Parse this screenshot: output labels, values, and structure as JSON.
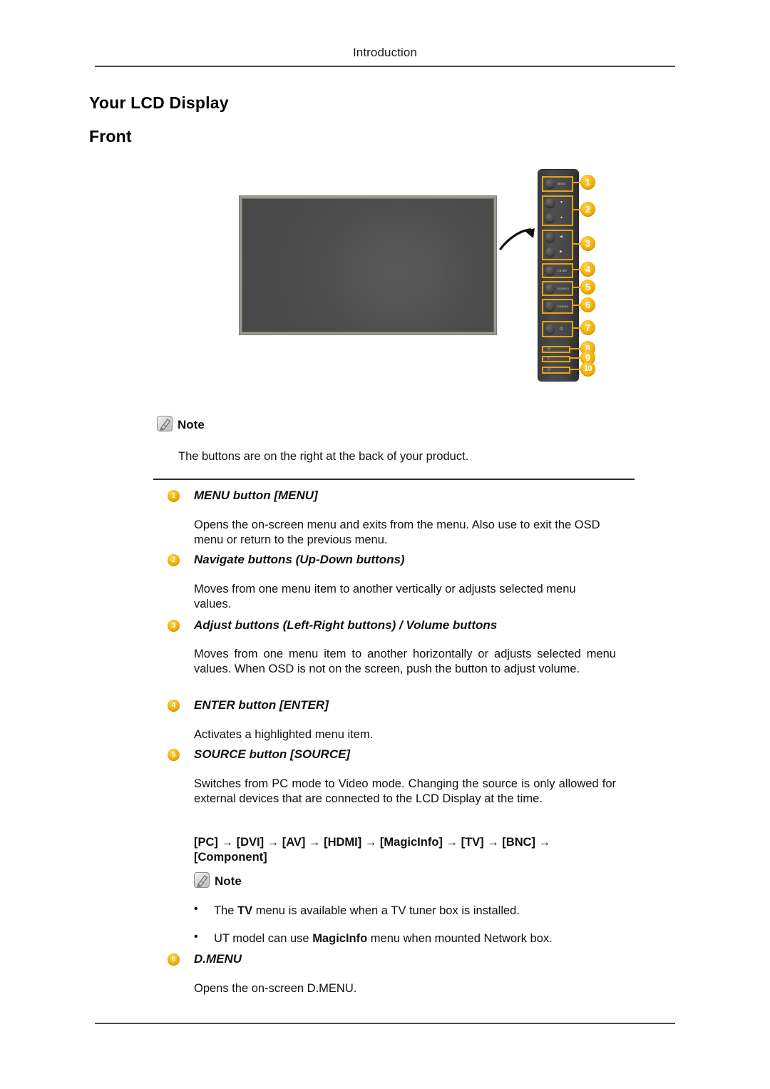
{
  "header": {
    "running_head": "Introduction"
  },
  "headings": {
    "h1": "Your LCD Display",
    "h2": "Front"
  },
  "figure": {
    "name": "lcd-display-front-with-control-panel",
    "panel_buttons": [
      {
        "label": "MENU",
        "glyph": ""
      },
      {
        "label": "",
        "glyph": "▼"
      },
      {
        "label": "",
        "glyph": "▲"
      },
      {
        "label": "",
        "glyph": "◄"
      },
      {
        "label": "",
        "glyph": "►"
      },
      {
        "label": "ENTER",
        "glyph": ""
      },
      {
        "label": "SOURCE",
        "glyph": ""
      },
      {
        "label": "D.MENU",
        "glyph": ""
      },
      {
        "label": "",
        "glyph": "⏻"
      }
    ],
    "callouts": [
      "1",
      "2",
      "3",
      "4",
      "5",
      "6",
      "7",
      "8",
      "9",
      "10"
    ],
    "accent_color": "#E8A317"
  },
  "note_top": {
    "label": "Note",
    "text": "The buttons are on the right at the back of your product."
  },
  "items": [
    {
      "num": "1",
      "title": "MENU button [MENU]",
      "body": "Opens the on-screen menu and exits from the menu. Also use to exit the OSD menu or return to the previous menu."
    },
    {
      "num": "2",
      "title": "Navigate buttons (Up-Down buttons)",
      "body": "Moves from one menu item to another vertically or adjusts selected menu values."
    },
    {
      "num": "3",
      "title": "Adjust buttons (Left-Right buttons) / Volume buttons",
      "body": "Moves from one menu item to another horizontally or adjusts selected menu values. When OSD is not on the screen, push the button to adjust volume."
    },
    {
      "num": "4",
      "title": "ENTER button [ENTER]",
      "body": "Activates a highlighted menu item."
    },
    {
      "num": "5",
      "title": "SOURCE button [SOURCE]",
      "body": "Switches from PC mode to Video mode. Changing the source is only allowed for external devices that are connected to the LCD Display at the time.",
      "chain": "[PC] → [DVI] → [AV] → [HDMI] → [MagicInfo] → [TV] → [BNC] → [Component]"
    },
    {
      "num": "6",
      "title": "D.MENU",
      "body": "Opens the on-screen D.MENU."
    }
  ],
  "note_bottom": {
    "label": "Note",
    "bullet_marker": "•",
    "bullets": [
      {
        "pre": "The ",
        "bold": "TV",
        "post": " menu is available when a TV tuner box is installed."
      },
      {
        "pre": "UT model can use ",
        "bold": "MagicInfo",
        "post": " menu when mounted Network box."
      }
    ]
  }
}
